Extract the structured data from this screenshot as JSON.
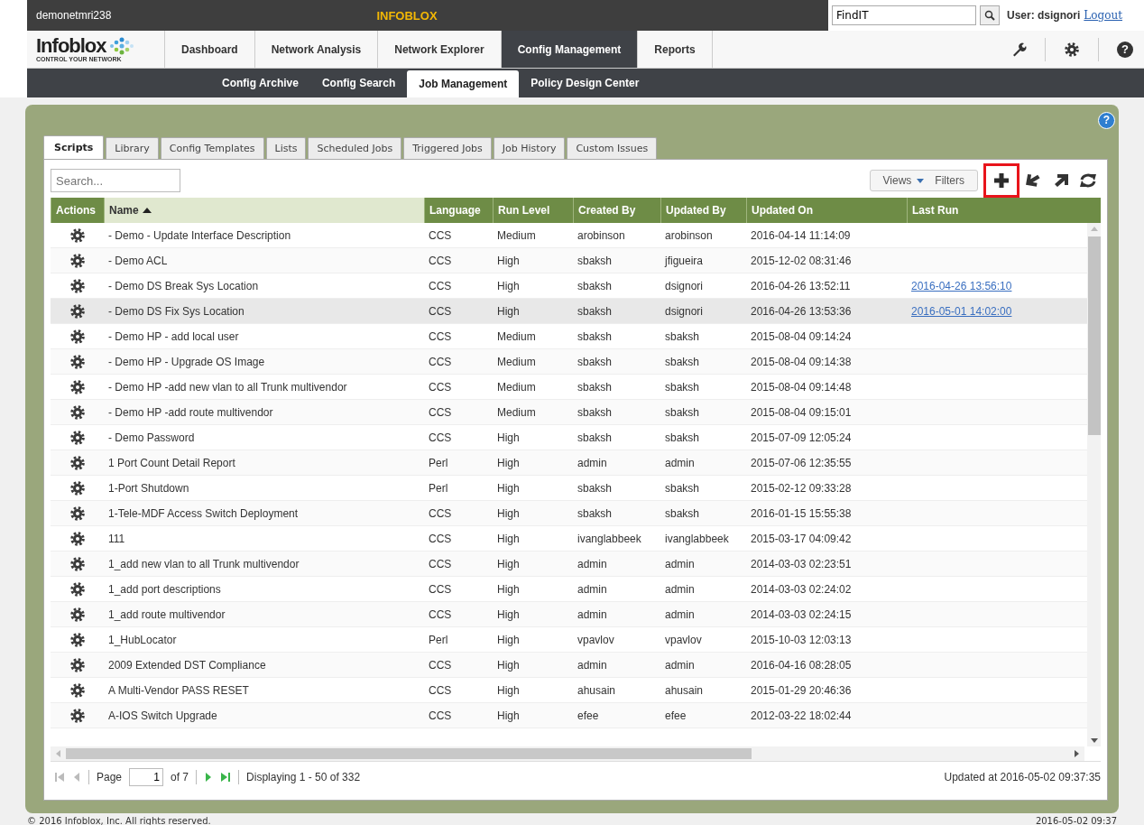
{
  "top_bar": {
    "host": "demonetmri238",
    "product": "INFOBLOX",
    "search": {
      "value": "FindIT"
    },
    "user": "User: dsignori",
    "logout": "Logout"
  },
  "logo": {
    "name": "Infoblox",
    "tagline": "CONTROL YOUR NETWORK"
  },
  "nav": [
    {
      "label": "Dashboard",
      "selected": false
    },
    {
      "label": "Network Analysis",
      "selected": false
    },
    {
      "label": "Network Explorer",
      "selected": false
    },
    {
      "label": "Config Management",
      "selected": true
    },
    {
      "label": "Reports",
      "selected": false
    }
  ],
  "nav_tools": [
    {
      "kind": "wrench"
    },
    {
      "kind": "settings"
    },
    {
      "kind": "help",
      "label": "?"
    }
  ],
  "subnav": [
    {
      "label": "Config Archive",
      "selected": false
    },
    {
      "label": "Config Search",
      "selected": false
    },
    {
      "label": "Job Management",
      "selected": true
    },
    {
      "label": "Policy Design Center",
      "selected": false
    }
  ],
  "panel_help": "?",
  "tabs": [
    {
      "label": "Scripts",
      "selected": true
    },
    {
      "label": "Library",
      "selected": false
    },
    {
      "label": "Config Templates",
      "selected": false
    },
    {
      "label": "Lists",
      "selected": false
    },
    {
      "label": "Scheduled Jobs",
      "selected": false
    },
    {
      "label": "Triggered Jobs",
      "selected": false
    },
    {
      "label": "Job History",
      "selected": false
    },
    {
      "label": "Custom Issues",
      "selected": false
    }
  ],
  "toolbar": {
    "search": {
      "placeholder": "Search..."
    },
    "views": "Views",
    "filters": "Filters",
    "tools": [
      {
        "kind": "add",
        "highlighted": true
      },
      {
        "kind": "import",
        "highlighted": false
      },
      {
        "kind": "export",
        "highlighted": false
      },
      {
        "kind": "refresh",
        "highlighted": false
      }
    ]
  },
  "table": {
    "columns": [
      {
        "label": "Actions",
        "sorted": false
      },
      {
        "label": "Name",
        "sorted": true
      },
      {
        "label": "Language",
        "sorted": false
      },
      {
        "label": "Run Level",
        "sorted": false
      },
      {
        "label": "Created By",
        "sorted": false
      },
      {
        "label": "Updated By",
        "sorted": false
      },
      {
        "label": "Updated On",
        "sorted": false
      },
      {
        "label": "Last Run",
        "sorted": false
      }
    ],
    "rows": [
      {
        "name": "- Demo - Update Interface Description",
        "language": "CCS",
        "run_level": "Medium",
        "created_by": "arobinson",
        "updated_by": "arobinson",
        "updated_on": "2016-04-14 11:14:09",
        "selected": false
      },
      {
        "name": "- Demo ACL",
        "language": "CCS",
        "run_level": "High",
        "created_by": "sbaksh",
        "updated_by": "jfigueira",
        "updated_on": "2015-12-02 08:31:46",
        "selected": false
      },
      {
        "name": "- Demo DS Break Sys Location",
        "language": "CCS",
        "run_level": "High",
        "created_by": "sbaksh",
        "updated_by": "dsignori",
        "updated_on": "2016-04-26 13:52:11",
        "last_run": "2016-04-26 13:56:10",
        "selected": false
      },
      {
        "name": "- Demo DS Fix Sys Location",
        "language": "CCS",
        "run_level": "High",
        "created_by": "sbaksh",
        "updated_by": "dsignori",
        "updated_on": "2016-04-26 13:53:36",
        "last_run": "2016-05-01 14:02:00",
        "selected": true
      },
      {
        "name": "- Demo HP - add local user",
        "language": "CCS",
        "run_level": "Medium",
        "created_by": "sbaksh",
        "updated_by": "sbaksh",
        "updated_on": "2015-08-04 09:14:24",
        "selected": false
      },
      {
        "name": "- Demo HP - Upgrade OS Image",
        "language": "CCS",
        "run_level": "Medium",
        "created_by": "sbaksh",
        "updated_by": "sbaksh",
        "updated_on": "2015-08-04 09:14:38",
        "selected": false
      },
      {
        "name": "- Demo HP -add new vlan to all Trunk multivendor",
        "language": "CCS",
        "run_level": "Medium",
        "created_by": "sbaksh",
        "updated_by": "sbaksh",
        "updated_on": "2015-08-04 09:14:48",
        "selected": false
      },
      {
        "name": "- Demo HP -add route multivendor",
        "language": "CCS",
        "run_level": "Medium",
        "created_by": "sbaksh",
        "updated_by": "sbaksh",
        "updated_on": "2015-08-04 09:15:01",
        "selected": false
      },
      {
        "name": "- Demo Password",
        "language": "CCS",
        "run_level": "High",
        "created_by": "sbaksh",
        "updated_by": "sbaksh",
        "updated_on": "2015-07-09 12:05:24",
        "selected": false
      },
      {
        "name": "1 Port Count Detail Report",
        "language": "Perl",
        "run_level": "High",
        "created_by": "admin",
        "updated_by": "admin",
        "updated_on": "2015-07-06 12:35:55",
        "selected": false
      },
      {
        "name": "1-Port Shutdown",
        "language": "Perl",
        "run_level": "High",
        "created_by": "sbaksh",
        "updated_by": "sbaksh",
        "updated_on": "2015-02-12 09:33:28",
        "selected": false
      },
      {
        "name": "1-Tele-MDF Access Switch Deployment",
        "language": "CCS",
        "run_level": "High",
        "created_by": "sbaksh",
        "updated_by": "sbaksh",
        "updated_on": "2016-01-15 15:55:38",
        "selected": false
      },
      {
        "name": "111",
        "language": "CCS",
        "run_level": "High",
        "created_by": "ivanglabbeek",
        "updated_by": "ivanglabbeek",
        "updated_on": "2015-03-17 04:09:42",
        "selected": false
      },
      {
        "name": "1_add new vlan to all Trunk multivendor",
        "language": "CCS",
        "run_level": "High",
        "created_by": "admin",
        "updated_by": "admin",
        "updated_on": "2014-03-03 02:23:51",
        "selected": false
      },
      {
        "name": "1_add port descriptions",
        "language": "CCS",
        "run_level": "High",
        "created_by": "admin",
        "updated_by": "admin",
        "updated_on": "2014-03-03 02:24:02",
        "selected": false
      },
      {
        "name": "1_add route multivendor",
        "language": "CCS",
        "run_level": "High",
        "created_by": "admin",
        "updated_by": "admin",
        "updated_on": "2014-03-03 02:24:15",
        "selected": false
      },
      {
        "name": "1_HubLocator",
        "language": "Perl",
        "run_level": "High",
        "created_by": "vpavlov",
        "updated_by": "vpavlov",
        "updated_on": "2015-10-03 12:03:13",
        "selected": false
      },
      {
        "name": "2009 Extended DST Compliance",
        "language": "CCS",
        "run_level": "High",
        "created_by": "admin",
        "updated_by": "admin",
        "updated_on": "2016-04-16 08:28:05",
        "selected": false
      },
      {
        "name": "A Multi-Vendor PASS RESET",
        "language": "CCS",
        "run_level": "High",
        "created_by": "ahusain",
        "updated_by": "ahusain",
        "updated_on": "2015-01-29 20:46:36",
        "selected": false
      },
      {
        "name": "A-IOS Switch Upgrade",
        "language": "CCS",
        "run_level": "High",
        "created_by": "efee",
        "updated_by": "efee",
        "updated_on": "2012-03-22 18:02:44",
        "selected": false
      }
    ]
  },
  "pager": {
    "first_disabled": true,
    "prev_disabled": true,
    "next_disabled": false,
    "last_disabled": false,
    "page_label": "Page",
    "page": "1",
    "of": "of 7",
    "displaying": "Displaying 1 - 50 of 332",
    "updated": "Updated at 2016-05-02 09:37:35"
  },
  "footer": {
    "copyright": "© 2016 Infoblox, Inc. All rights reserved.",
    "time": "2016-05-02 09:37"
  }
}
